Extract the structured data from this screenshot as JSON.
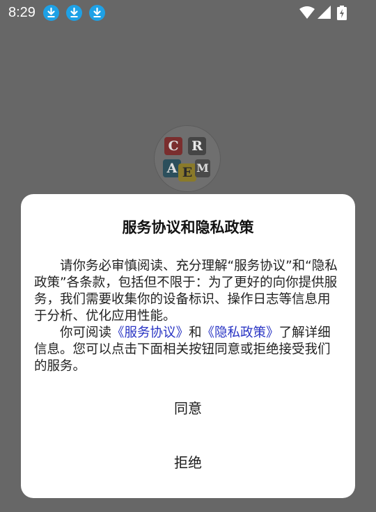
{
  "status_bar": {
    "time": "8:29",
    "notifications": [
      "download-icon",
      "download-icon",
      "download-icon"
    ],
    "system_icons": [
      "wifi-icon",
      "signal-icon",
      "battery-charging-icon"
    ]
  },
  "logo": {
    "letters": [
      "C",
      "R",
      "A",
      "E",
      "M"
    ]
  },
  "dialog": {
    "title": "服务协议和隐私政策",
    "paragraph1": "请你务必审慎阅读、充分理解“服务协议”和“隐私政策”各条款，包括但不限于：为了更好的向你提供服务，我们需要收集你的设备标识、操作日志等信息用于分析、优化应用性能。",
    "paragraph2_prefix": "你可阅读",
    "service_link": "《服务协议》",
    "paragraph2_and": "和",
    "privacy_link": "《隐私政策》",
    "paragraph2_suffix": "了解详细信息。您可以点击下面相关按钮同意或拒绝接受我们的服务。",
    "agree_label": "同意",
    "reject_label": "拒绝"
  },
  "colors": {
    "overlay": "#676767",
    "link": "#2a35c4",
    "notification": "#1ea1e6"
  }
}
